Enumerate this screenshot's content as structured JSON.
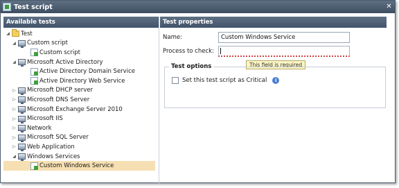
{
  "window": {
    "title": "Test script"
  },
  "left_panel": {
    "header": "Available tests"
  },
  "tree": [
    {
      "label": "Test",
      "depth": 0,
      "toggle": "expanded",
      "icon": "folder-icon"
    },
    {
      "label": "Custom script",
      "depth": 1,
      "toggle": "expanded",
      "icon": "server-icon"
    },
    {
      "label": "Custom script",
      "depth": 2,
      "toggle": "none",
      "icon": "script-icon"
    },
    {
      "label": "Microsoft Active Directory",
      "depth": 1,
      "toggle": "expanded",
      "icon": "server-icon"
    },
    {
      "label": "Active Directory Domain Service",
      "depth": 2,
      "toggle": "none",
      "icon": "script-icon"
    },
    {
      "label": "Active Directory Web Service",
      "depth": 2,
      "toggle": "none",
      "icon": "script-icon"
    },
    {
      "label": "Microsoft DHCP server",
      "depth": 1,
      "toggle": "collapsed",
      "icon": "server-icon"
    },
    {
      "label": "Microsoft DNS Server",
      "depth": 1,
      "toggle": "collapsed",
      "icon": "server-icon"
    },
    {
      "label": "Microsoft Exchange Server 2010",
      "depth": 1,
      "toggle": "collapsed",
      "icon": "server-icon"
    },
    {
      "label": "Microsoft IIS",
      "depth": 1,
      "toggle": "collapsed",
      "icon": "server-icon"
    },
    {
      "label": "Network",
      "depth": 1,
      "toggle": "collapsed",
      "icon": "server-icon"
    },
    {
      "label": "Microsoft SQL Server",
      "depth": 1,
      "toggle": "collapsed",
      "icon": "server-icon"
    },
    {
      "label": "Web Application",
      "depth": 1,
      "toggle": "collapsed",
      "icon": "server-icon"
    },
    {
      "label": "Windows Services",
      "depth": 1,
      "toggle": "expanded",
      "icon": "server-icon"
    },
    {
      "label": "Custom Windows Service",
      "depth": 2,
      "toggle": "none",
      "icon": "script-icon",
      "selected": true
    }
  ],
  "right_panel": {
    "header": "Test properties",
    "name_label": "Name:",
    "name_value": "Custom Windows Service",
    "process_label": "Process to check:",
    "process_value": "",
    "validation_tooltip": "This field is required",
    "options_legend": "Test options",
    "critical_label": "Set this test script as Critical",
    "critical_checked": false,
    "info_icon": "i"
  }
}
